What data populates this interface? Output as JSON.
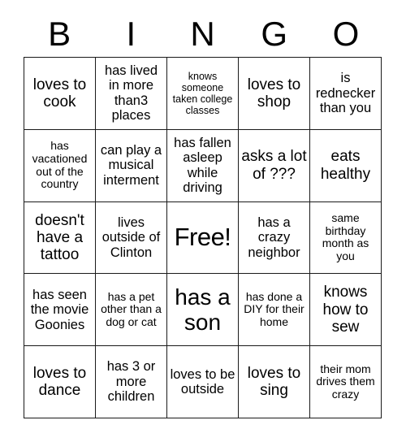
{
  "title": "BINGO",
  "header": {
    "letters": [
      "B",
      "I",
      "N",
      "G",
      "O"
    ]
  },
  "grid": {
    "rows": 5,
    "columns": 5,
    "border_color": "#1a1a1a",
    "background_color": "#ffffff",
    "text_color": "#000000",
    "cells": [
      [
        {
          "text": "loves to cook",
          "size": "lg"
        },
        {
          "text": "has lived in more than3 places",
          "size": "md"
        },
        {
          "text": "knows someone taken college classes",
          "size": "xs"
        },
        {
          "text": "loves to shop",
          "size": "lg"
        },
        {
          "text": "is rednecker than you",
          "size": "md"
        }
      ],
      [
        {
          "text": "has vacationed out of the country",
          "size": "sm"
        },
        {
          "text": "can play a musical interment",
          "size": "md"
        },
        {
          "text": "has fallen asleep while driving",
          "size": "md"
        },
        {
          "text": "asks a lot of ???",
          "size": "lg"
        },
        {
          "text": "eats healthy",
          "size": "lg"
        }
      ],
      [
        {
          "text": "doesn't have a tattoo",
          "size": "lg"
        },
        {
          "text": "lives outside of Clinton",
          "size": "md"
        },
        {
          "text": "Free!",
          "size": "free"
        },
        {
          "text": "has a crazy neighbor",
          "size": "md"
        },
        {
          "text": "same birthday month as you",
          "size": "sm"
        }
      ],
      [
        {
          "text": "has seen the movie Goonies",
          "size": "md"
        },
        {
          "text": "has a pet other than a dog or cat",
          "size": "sm"
        },
        {
          "text": "has a son",
          "size": "xl"
        },
        {
          "text": "has done a DIY for their home",
          "size": "sm"
        },
        {
          "text": "knows how to sew",
          "size": "lg"
        }
      ],
      [
        {
          "text": "loves to dance",
          "size": "lg"
        },
        {
          "text": "has 3 or more children",
          "size": "md"
        },
        {
          "text": "loves to be outside",
          "size": "md"
        },
        {
          "text": "loves to sing",
          "size": "lg"
        },
        {
          "text": "their mom drives them crazy",
          "size": "sm"
        }
      ]
    ]
  }
}
